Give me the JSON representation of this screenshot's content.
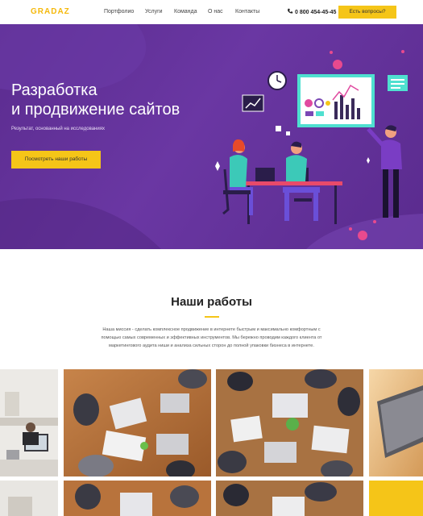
{
  "header": {
    "logo": "GRADAZ",
    "nav": [
      "Портфолио",
      "Услуги",
      "Команда",
      "О нас",
      "Контакты"
    ],
    "phone": "0 800 454-45-45",
    "ask_button": "Есть вопросы?"
  },
  "hero": {
    "title_line1": "Разработка",
    "title_line2": "и продвижение сайтов",
    "subtitle": "Результат, основанный на исследованиях",
    "button": "Посмотреть наши работы"
  },
  "works": {
    "title": "Наши работы",
    "desc_line1": "Наша миссия - сделать комплексное продвижение в интернете быстрым и максимально комфортным с",
    "desc_line2": "помощью самых современных и эффективных инструментов. Мы бережно проводим каждого клиента от",
    "desc_line3": "маркетингового аудита ниши и анализа сильных сторон до полной упаковки бизнеса в интернете."
  },
  "colors": {
    "accent": "#f5c518",
    "logo": "#f5b90c",
    "hero_bg": "#5b2c8f"
  },
  "icons": [
    "phone-icon",
    "clock-icon",
    "chart-icon",
    "chat-icon"
  ]
}
